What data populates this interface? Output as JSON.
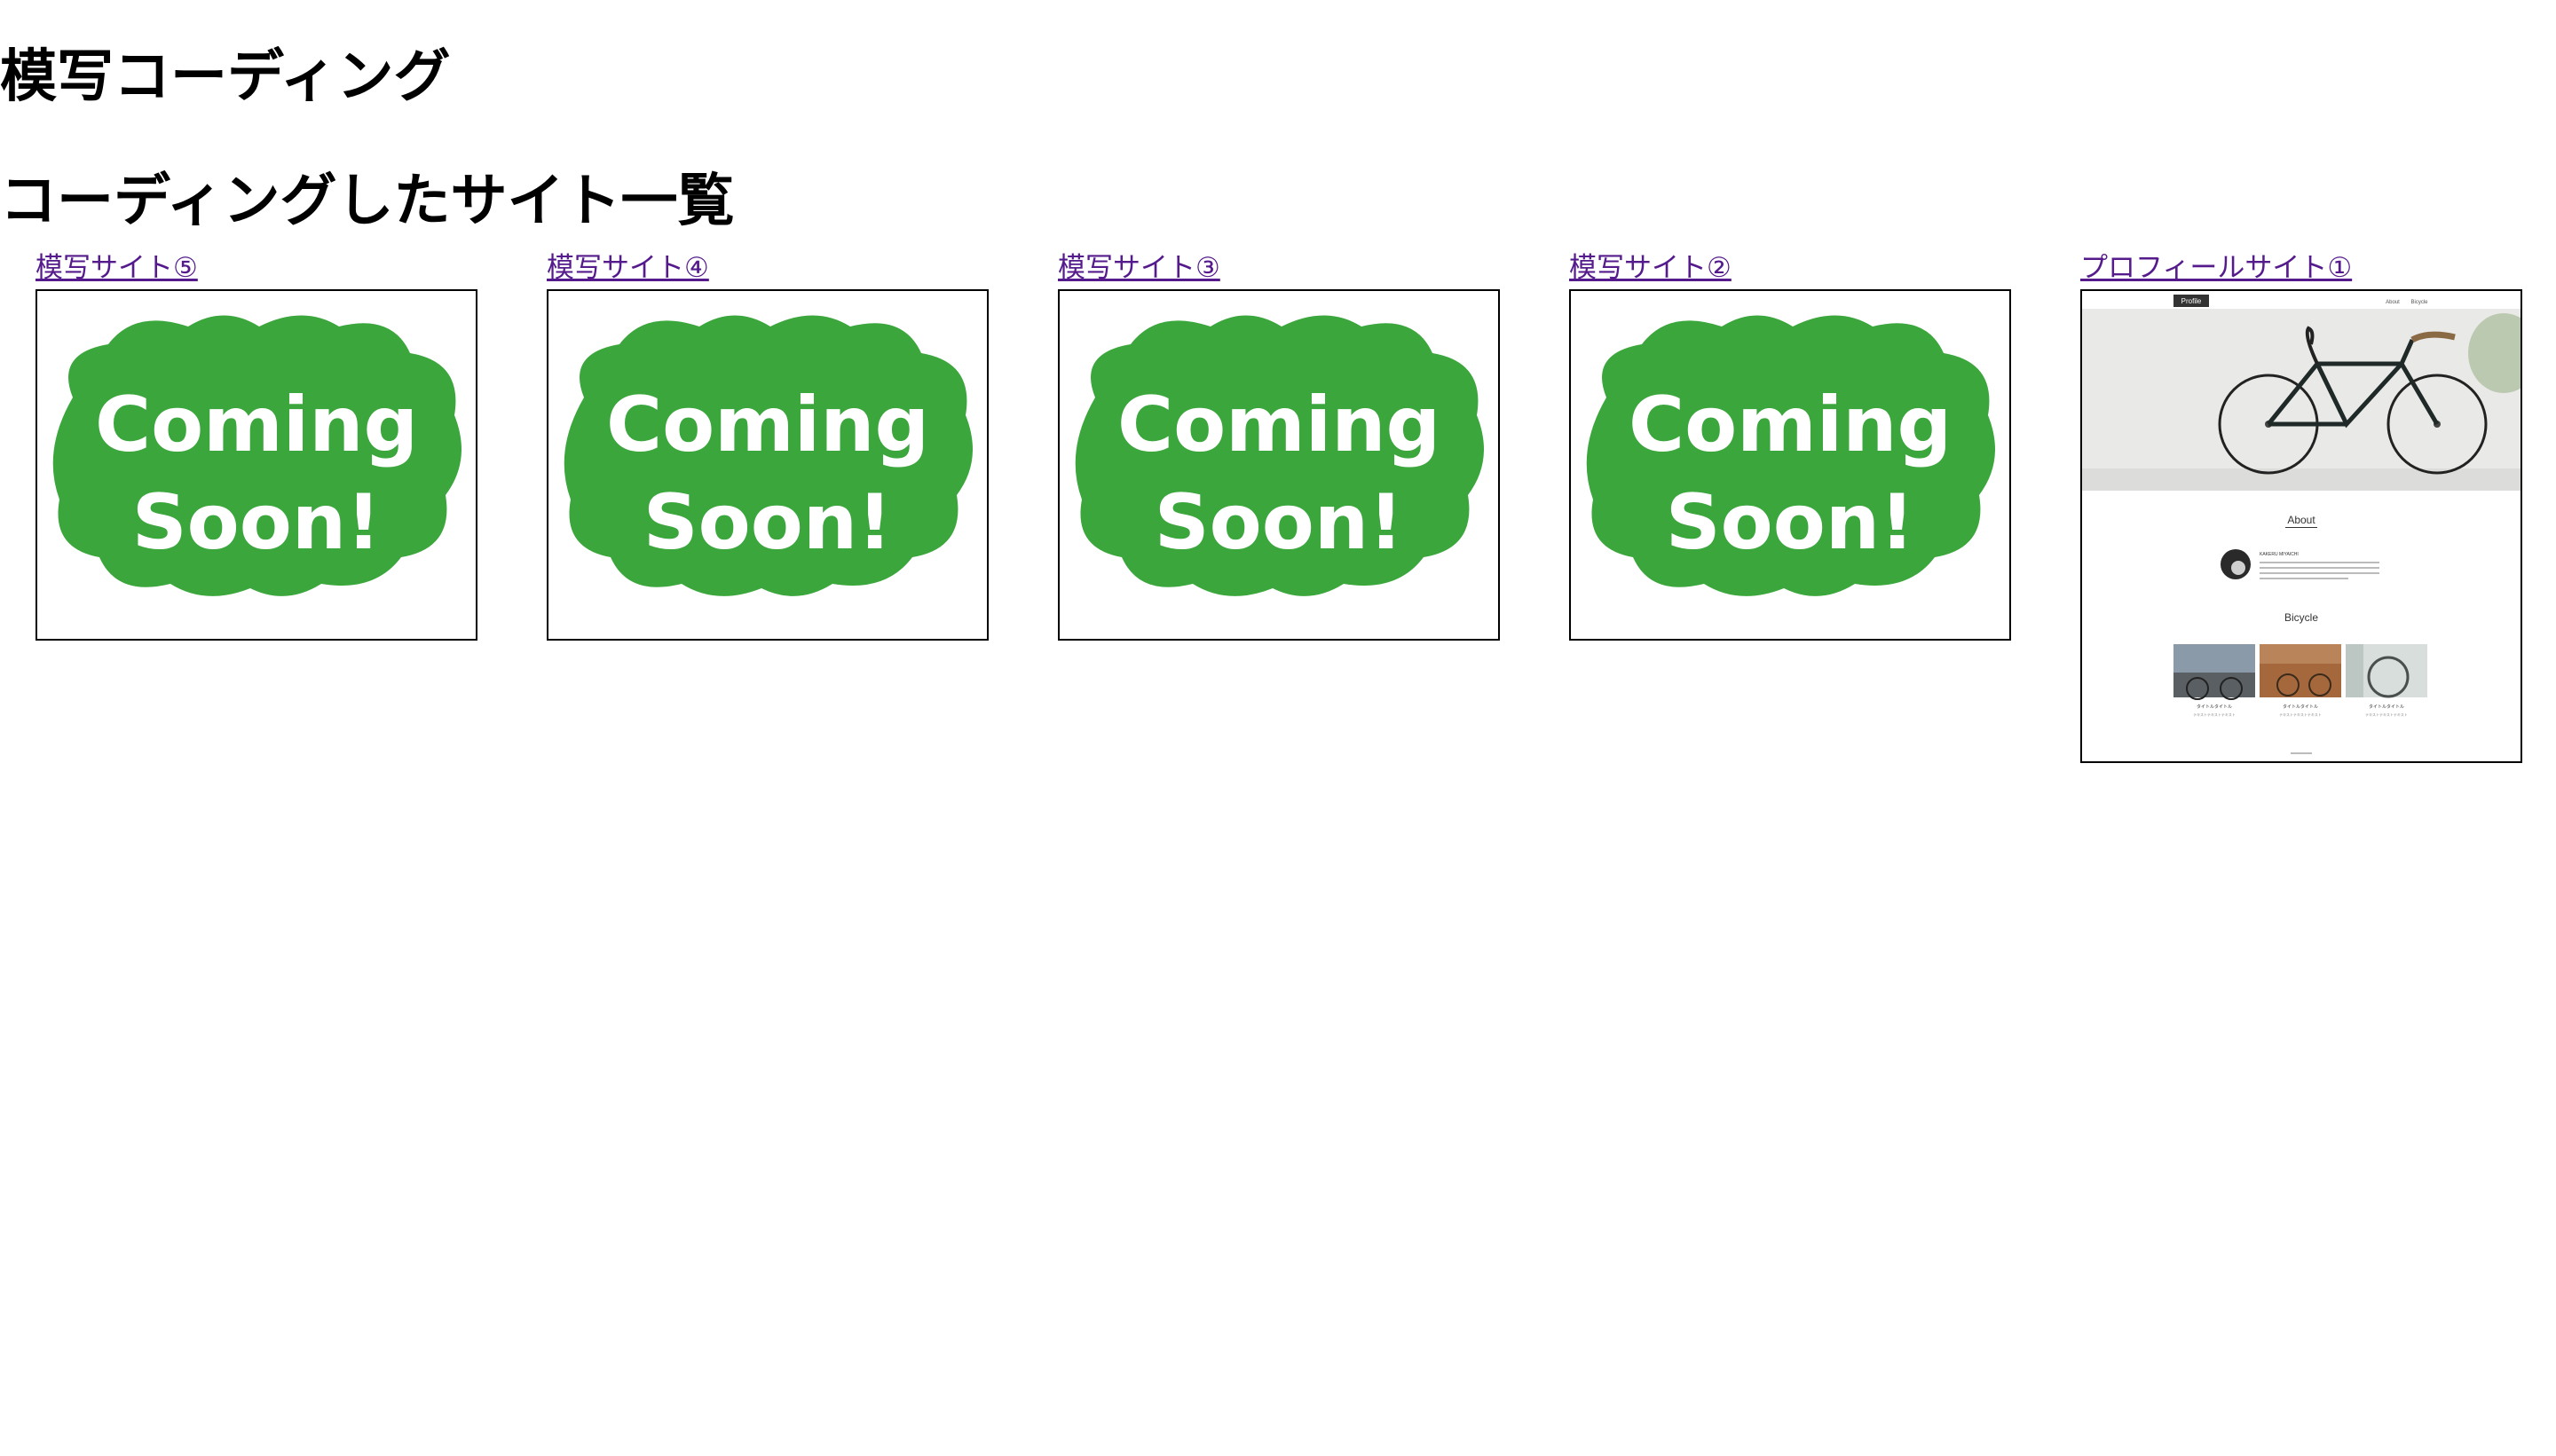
{
  "page": {
    "title": "模写コーディング",
    "subtitle": "コーディングしたサイト一覧"
  },
  "sites": [
    {
      "label": "模写サイト⑤",
      "thumbnail": "coming-soon"
    },
    {
      "label": "模写サイト④",
      "thumbnail": "coming-soon"
    },
    {
      "label": "模写サイト③",
      "thumbnail": "coming-soon"
    },
    {
      "label": "模写サイト②",
      "thumbnail": "coming-soon"
    },
    {
      "label": "プロフィールサイト①",
      "thumbnail": "profile-site"
    }
  ],
  "coming_soon": {
    "line1": "Coming",
    "line2": "Soon!"
  },
  "profile_preview": {
    "logo": "Profile",
    "nav": [
      "About",
      "Bicycle"
    ],
    "about_heading": "About",
    "name": "KAKERU MIYAICHI",
    "bicycle_heading": "Bicycle",
    "items": [
      {
        "title": "タイトルタイトル",
        "text": "テキストテキストテキスト"
      },
      {
        "title": "タイトルタイトル",
        "text": "テキストテキストテキスト"
      },
      {
        "title": "タイトルタイトル",
        "text": "テキストテキストテキスト"
      }
    ]
  },
  "colors": {
    "link": "#551a8b",
    "soon_green": "#3aa63c",
    "logo_bg": "#333333"
  }
}
